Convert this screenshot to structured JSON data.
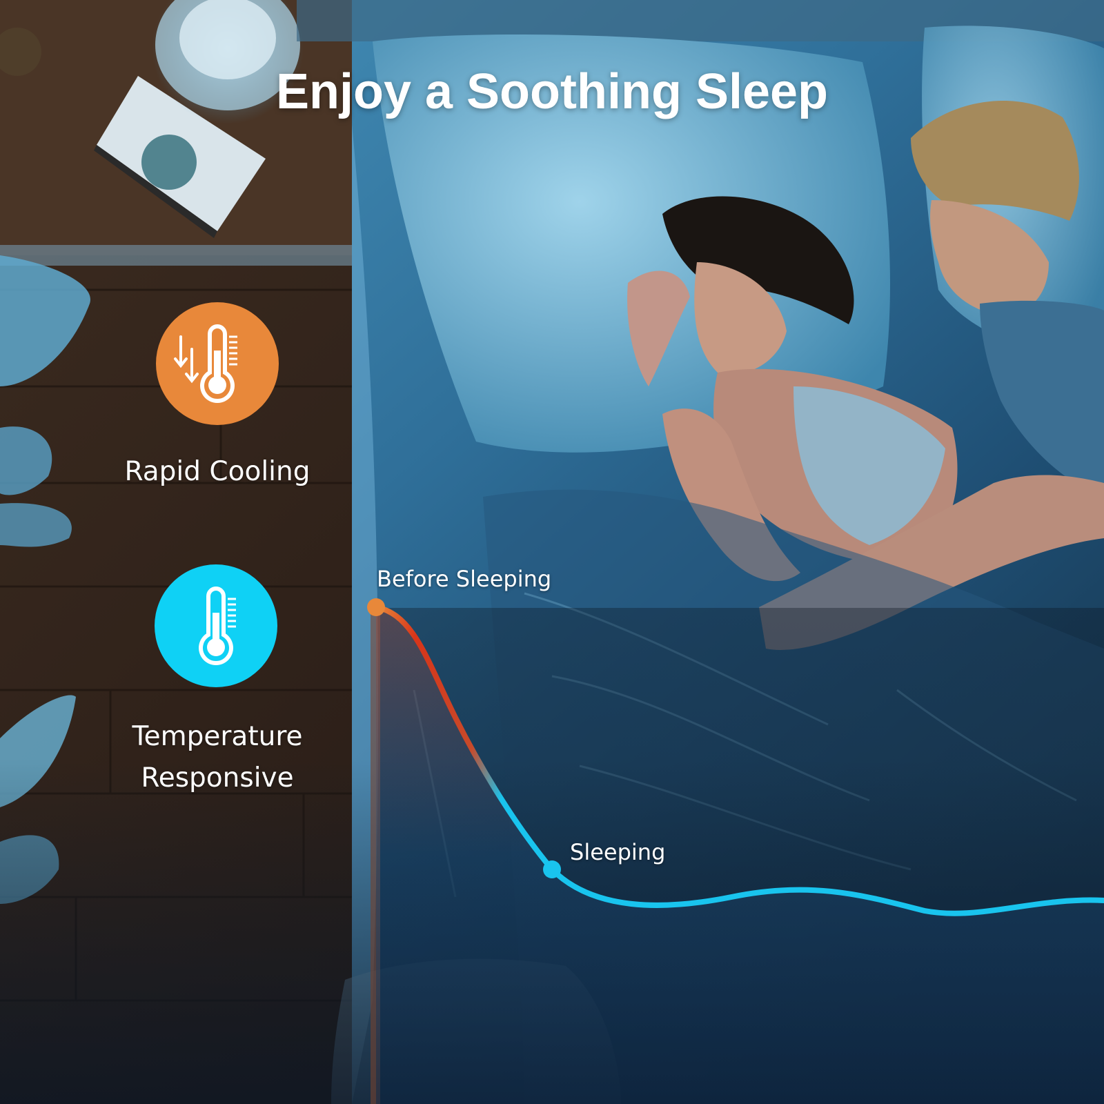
{
  "title": "Enjoy a Soothing Sleep",
  "features": [
    {
      "label": "Rapid Cooling",
      "icon": "thermometer-cooling-icon",
      "color": "#E8883A"
    },
    {
      "label_line1": "Temperature",
      "label_line2": "Responsive",
      "icon": "thermometer-icon",
      "color": "#0FD1F5"
    }
  ],
  "curve": {
    "start_label": "Before Sleeping",
    "end_label": "Sleeping",
    "start_color": "#E8883A",
    "mid_color": "#D8351A",
    "end_color": "#19C4EE"
  },
  "colors": {
    "floor": "#3a2a20",
    "sheet": "#2f6f96",
    "text": "#ffffff"
  }
}
